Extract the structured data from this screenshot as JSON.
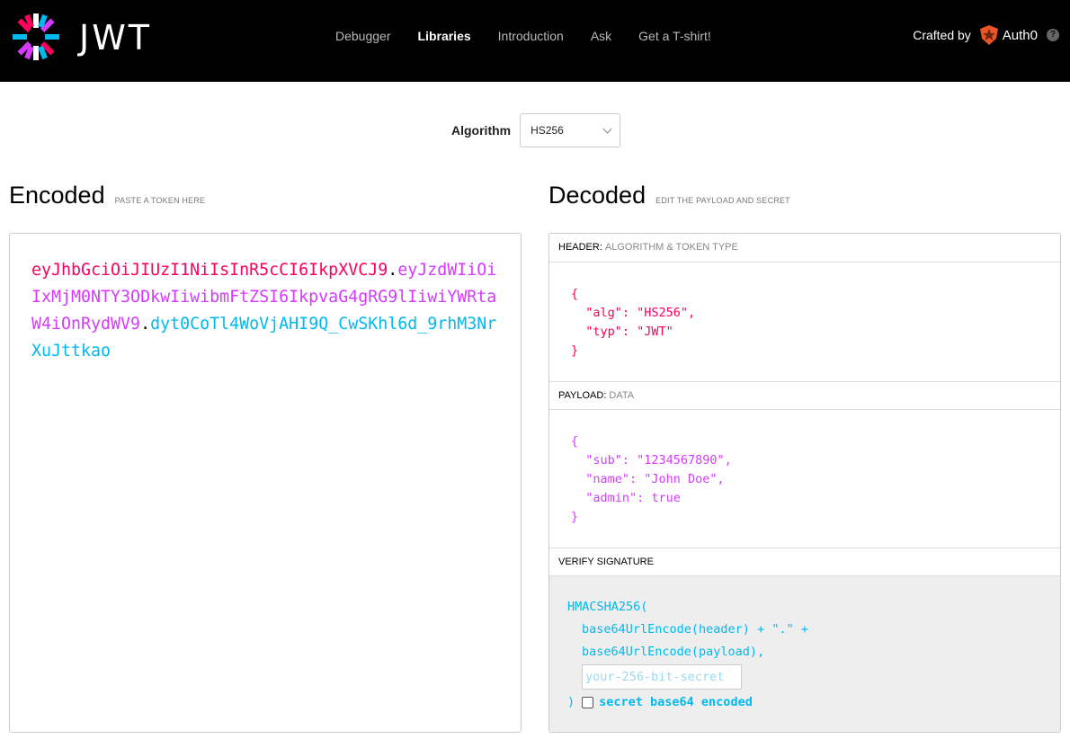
{
  "nav": {
    "logo_text": "JWT",
    "links": [
      {
        "label": "Debugger",
        "active": false
      },
      {
        "label": "Libraries",
        "active": true
      },
      {
        "label": "Introduction",
        "active": false
      },
      {
        "label": "Ask",
        "active": false
      },
      {
        "label": "Get a T-shirt!",
        "active": false
      }
    ],
    "crafted_by": "Crafted by",
    "brand": "Auth0",
    "help": "?"
  },
  "algorithm": {
    "label": "Algorithm",
    "selected": "HS256"
  },
  "encoded": {
    "title": "Encoded",
    "subtitle": "PASTE A TOKEN HERE",
    "token": {
      "header": "eyJhbGciOiJIUzI1NiIsInR5cCI6IkpXVCJ9",
      "payload": "eyJzdWIiOiIxMjM0NTY3ODkwIiwibmFtZSI6IkpvaG4gRG9lIiwiYWRtaW4iOnRydWV9",
      "signature": "dyt0CoTl4WoVjAHI9Q_CwSKhl6d_9rhM3NrXuJttkao",
      "dot": "."
    }
  },
  "decoded": {
    "title": "Decoded",
    "subtitle": "EDIT THE PAYLOAD AND SECRET",
    "header_panel": {
      "label": "HEADER:",
      "hint": "ALGORITHM & TOKEN TYPE",
      "json": "{\n  \"alg\": \"HS256\",\n  \"typ\": \"JWT\"\n}"
    },
    "payload_panel": {
      "label": "PAYLOAD:",
      "hint": "DATA",
      "json": "{\n  \"sub\": \"1234567890\",\n  \"name\": \"John Doe\",\n  \"admin\": true\n}"
    },
    "signature_panel": {
      "label": "VERIFY SIGNATURE",
      "line1": "HMACSHA256(",
      "line2": "base64UrlEncode(header) + \".\" +",
      "line3": "base64UrlEncode(payload),",
      "secret_placeholder": "your-256-bit-secret",
      "close": ")",
      "checkbox_label": "secret base64 encoded",
      "checkbox_checked": false
    }
  },
  "colors": {
    "header": "#fb015b",
    "payload": "#d63aff",
    "signature": "#00b9f1"
  }
}
